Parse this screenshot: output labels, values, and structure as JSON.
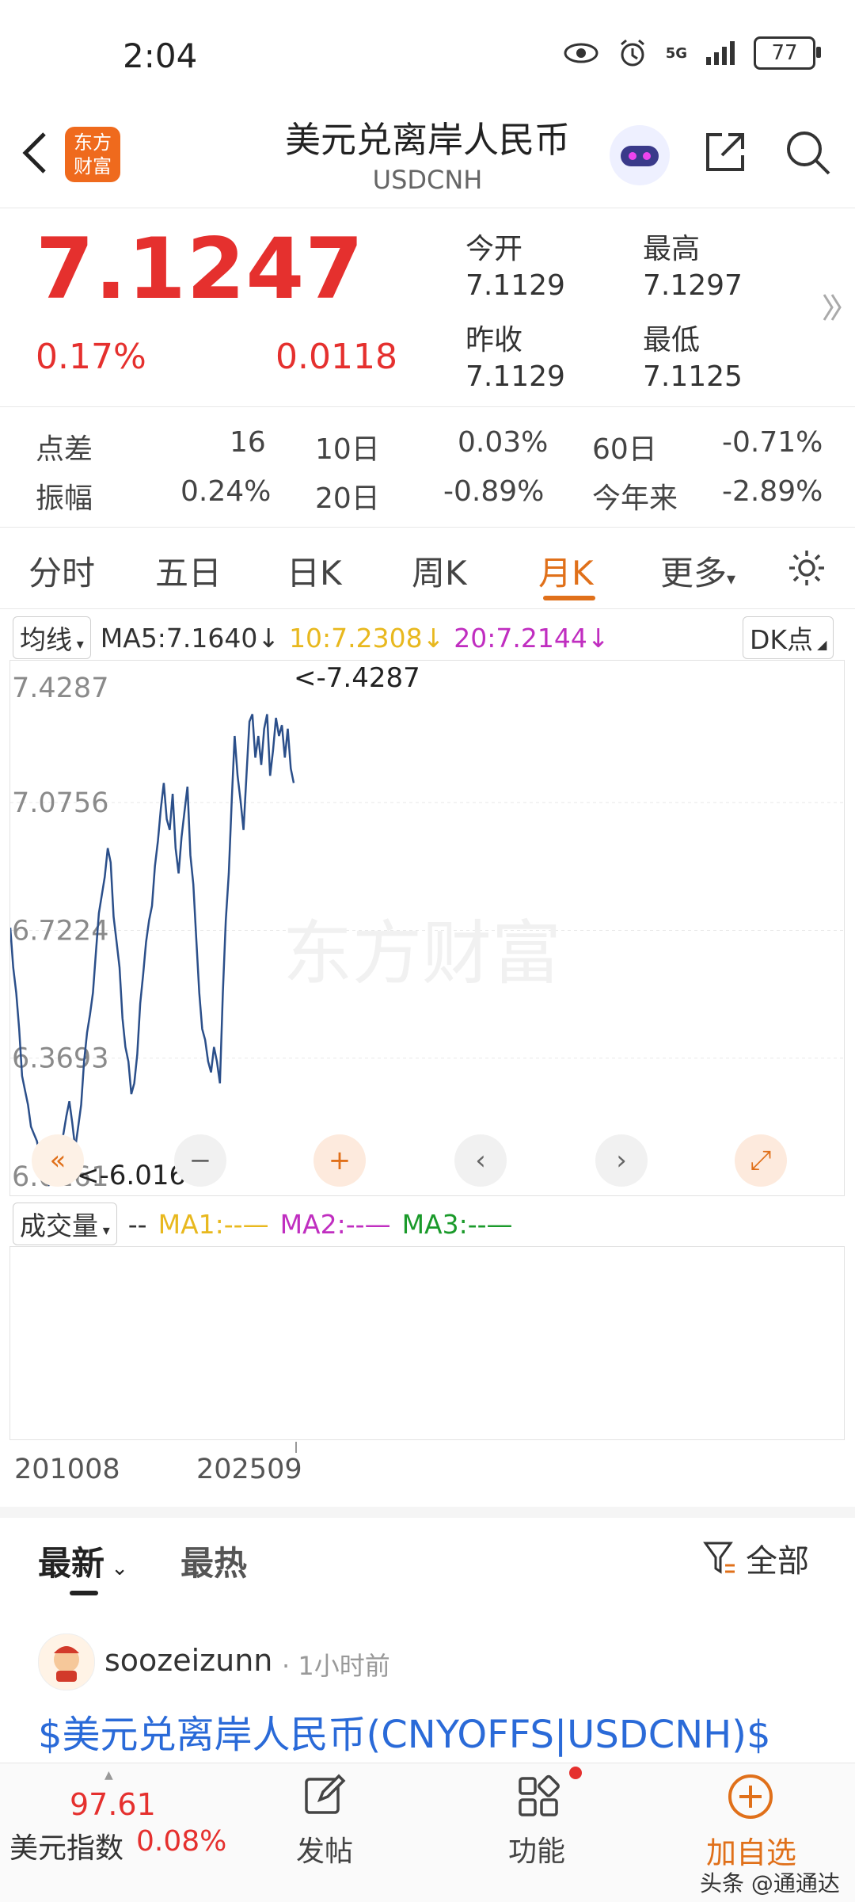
{
  "status_bar": {
    "time": "2:04",
    "network": "5G",
    "battery": "77"
  },
  "header": {
    "title": "美元兑离岸人民币",
    "subtitle": "USDCNH",
    "logo_text": "东方财富"
  },
  "quote": {
    "price": "7.1247",
    "change_pct": "0.17%",
    "change": "0.0118",
    "open_label": "今开",
    "open": "7.1129",
    "high_label": "最高",
    "high": "7.1297",
    "prev_close_label": "昨收",
    "prev_close": "7.1129",
    "low_label": "最低",
    "low": "7.1125"
  },
  "stats": {
    "spread_label": "点差",
    "spread": "16",
    "d10_label": "10日",
    "d10": "0.03%",
    "d60_label": "60日",
    "d60": "-0.71%",
    "amp_label": "振幅",
    "amp": "0.24%",
    "d20_label": "20日",
    "d20": "-0.89%",
    "ytd_label": "今年来",
    "ytd": "-2.89%"
  },
  "tabs": [
    "分时",
    "五日",
    "日K",
    "周K",
    "月K",
    "更多"
  ],
  "ma_bar": {
    "selector": "均线",
    "ma5": "MA5:7.1640",
    "ma10": "10:7.2308",
    "ma20": "20:7.2144",
    "dk": "DK点"
  },
  "chart_data": {
    "type": "line",
    "title": "",
    "y_ticks": [
      "7.4287",
      "7.0756",
      "6.7224",
      "6.3693",
      "6.0161"
    ],
    "ylim": [
      6.0161,
      7.4287
    ],
    "max_marker": "<-7.4287",
    "min_marker": "<-6.0161",
    "watermark": "东方财富",
    "x_ticks": [
      "201008",
      "202509"
    ],
    "values": [
      6.73,
      6.62,
      6.55,
      6.45,
      6.32,
      6.28,
      6.24,
      6.18,
      6.16,
      6.14,
      6.1,
      6.06,
      6.03,
      6.02,
      6.05,
      6.12,
      6.08,
      6.13,
      6.16,
      6.21,
      6.25,
      6.19,
      6.12,
      6.18,
      6.24,
      6.36,
      6.44,
      6.49,
      6.55,
      6.66,
      6.77,
      6.82,
      6.87,
      6.95,
      6.91,
      6.76,
      6.69,
      6.62,
      6.48,
      6.4,
      6.36,
      6.27,
      6.3,
      6.38,
      6.52,
      6.6,
      6.69,
      6.75,
      6.79,
      6.9,
      6.97,
      7.06,
      7.13,
      7.03,
      7.0,
      7.1,
      6.95,
      6.88,
      6.98,
      7.05,
      7.12,
      6.93,
      6.85,
      6.7,
      6.55,
      6.45,
      6.42,
      6.36,
      6.33,
      6.4,
      6.36,
      6.3,
      6.55,
      6.75,
      6.88,
      7.08,
      7.26,
      7.15,
      7.08,
      7.0,
      7.15,
      7.3,
      7.32,
      7.2,
      7.26,
      7.18,
      7.28,
      7.32,
      7.15,
      7.22,
      7.31,
      7.26,
      7.29,
      7.2,
      7.28,
      7.17,
      7.13
    ],
    "volume_label": "成交量",
    "volume_ma": [
      "--",
      "MA1:--",
      "MA2:--",
      "MA3:--"
    ]
  },
  "chart_controls": [
    "«",
    "−",
    "+",
    "‹",
    "›",
    "⤢"
  ],
  "feed": {
    "tab_latest": "最新",
    "tab_hot": "最热",
    "filter": "全部",
    "post": {
      "user": "soozeizunn",
      "time": "· 1小时前",
      "title": "$美元兑离岸人民币(CNYOFFS|USDCNH)$"
    }
  },
  "bottom_nav": {
    "index_value": "97.61",
    "index_name": "美元指数",
    "index_change": "0.08%",
    "post": "发帖",
    "functions": "功能",
    "add_watch": "加自选",
    "watermark": "头条 @通通达"
  },
  "colors": {
    "up": "#e5302e",
    "down": "#1a9a2a",
    "accent": "#e0701a",
    "line": "#2b4f8a"
  }
}
